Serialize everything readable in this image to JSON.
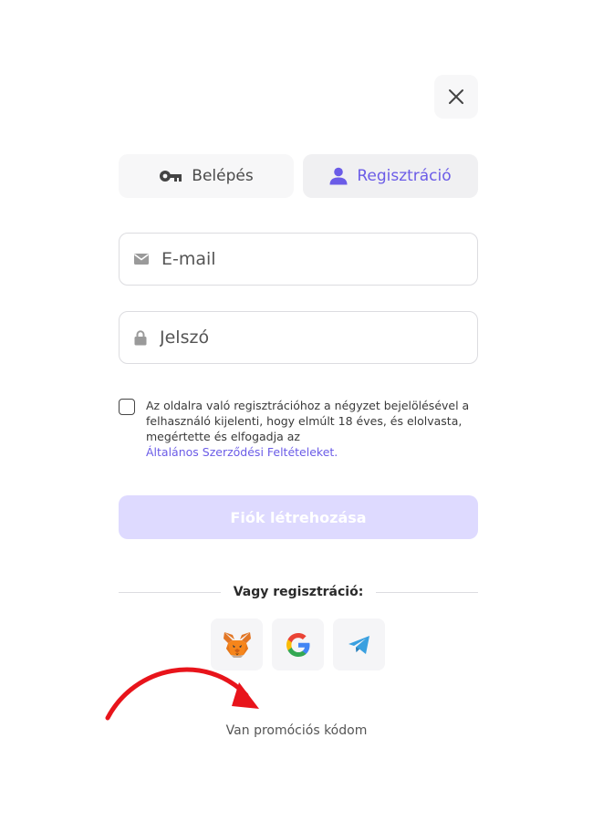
{
  "icons": {
    "close": "close-icon",
    "login_tab": "key-icon",
    "register_tab": "user-icon",
    "email": "envelope-icon",
    "password": "lock-icon",
    "metamask": "metamask-fox-icon",
    "google": "google-icon",
    "telegram": "telegram-icon"
  },
  "colors": {
    "accent": "#6b5ce7",
    "button_disabled": "#dedaff",
    "annotation_arrow": "#e8141b"
  },
  "tabs": {
    "login_label": "Belépés",
    "register_label": "Regisztráció",
    "active": "register"
  },
  "form": {
    "email_placeholder": "E-mail",
    "password_placeholder": "Jelszó",
    "email_value": "",
    "password_value": ""
  },
  "consent": {
    "checked": false,
    "text": "Az oldalra való regisztrációhoz a négyzet bejelölésével a felhasználó kijelenti, hogy elmúlt 18 éves, és elolvasta, megértette és elfogadja az",
    "link_text": "Általános Szerződési Feltételeket."
  },
  "submit_label": "Fiók létrehozása",
  "divider_label": "Vagy regisztráció:",
  "promo_label": "Van promóciós kódom"
}
